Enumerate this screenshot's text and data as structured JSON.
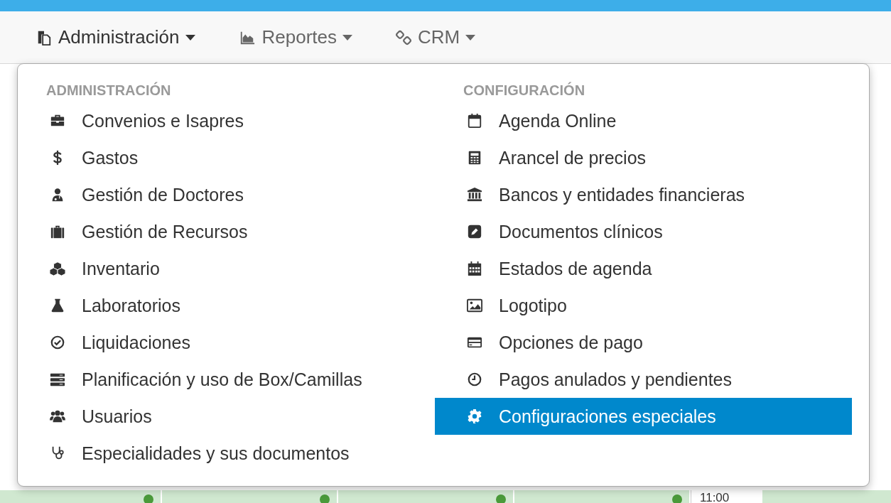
{
  "nav": [
    {
      "label": "Administración",
      "expanded": true
    },
    {
      "label": "Reportes",
      "expanded": false
    },
    {
      "label": "CRM",
      "expanded": false
    }
  ],
  "menu": {
    "columns": [
      {
        "heading": "ADMINISTRACIÓN",
        "items": [
          {
            "label": "Convenios e Isapres",
            "selected": false
          },
          {
            "label": "Gastos",
            "selected": false
          },
          {
            "label": "Gestión de Doctores",
            "selected": false
          },
          {
            "label": "Gestión de Recursos",
            "selected": false
          },
          {
            "label": "Inventario",
            "selected": false
          },
          {
            "label": "Laboratorios",
            "selected": false
          },
          {
            "label": "Liquidaciones",
            "selected": false
          },
          {
            "label": "Planificación y uso de Box/Camillas",
            "selected": false
          },
          {
            "label": "Usuarios",
            "selected": false
          },
          {
            "label": "Especialidades y sus documentos",
            "selected": false
          }
        ]
      },
      {
        "heading": "CONFIGURACIÓN",
        "items": [
          {
            "label": "Agenda Online",
            "selected": false
          },
          {
            "label": "Arancel de precios",
            "selected": false
          },
          {
            "label": "Bancos y entidades financieras",
            "selected": false
          },
          {
            "label": "Documentos clínicos",
            "selected": false
          },
          {
            "label": "Estados de agenda",
            "selected": false
          },
          {
            "label": "Logotipo",
            "selected": false
          },
          {
            "label": "Opciones de pago",
            "selected": false
          },
          {
            "label": "Pagos anulados y pendientes",
            "selected": false
          },
          {
            "label": "Configuraciones especiales",
            "selected": true
          }
        ]
      }
    ]
  },
  "calendar": {
    "time": "11:00"
  }
}
